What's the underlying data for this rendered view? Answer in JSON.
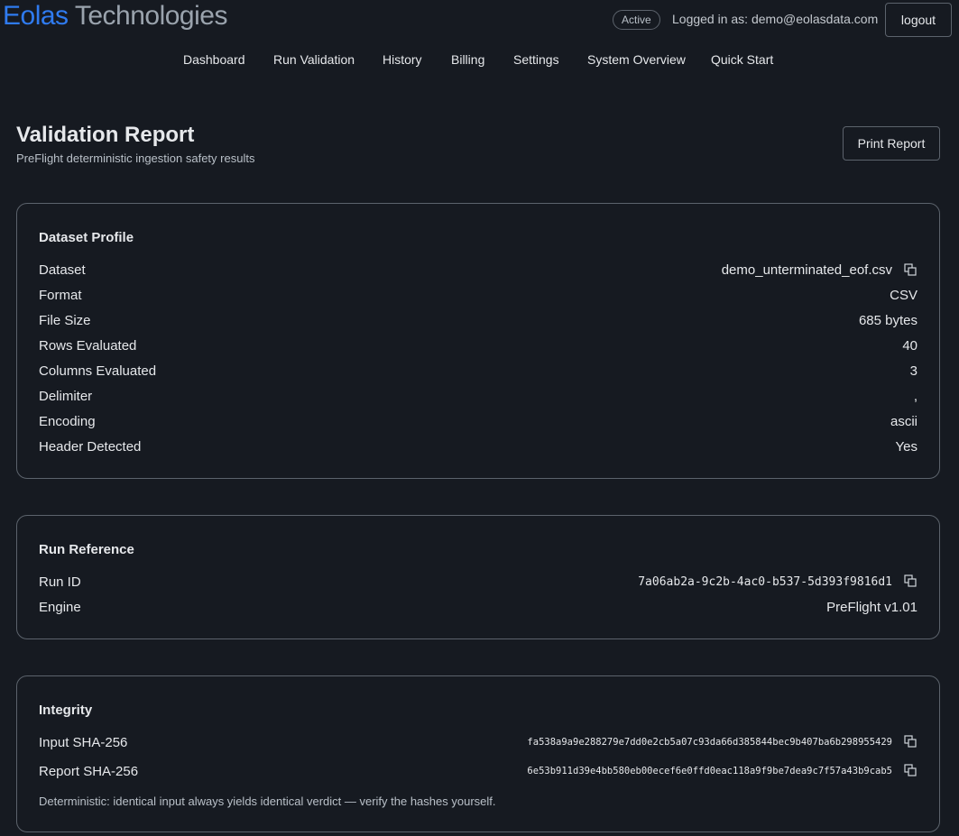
{
  "brand": {
    "part1": "Eolas",
    "part2": "Technologies"
  },
  "header": {
    "status": "Active",
    "logged_in": "Logged in as: demo@eolasdata.com",
    "logout_label": "logout"
  },
  "nav": {
    "items": [
      {
        "label": "Dashboard"
      },
      {
        "label": "Run Validation"
      },
      {
        "label": "History"
      },
      {
        "label": "Billing"
      },
      {
        "label": "Settings"
      },
      {
        "label": "System Overview"
      },
      {
        "label": "Quick Start"
      }
    ]
  },
  "page": {
    "title": "Validation Report",
    "subtitle": "PreFlight deterministic ingestion safety results",
    "print_label": "Print Report"
  },
  "dataset_profile": {
    "title": "Dataset Profile",
    "rows": [
      {
        "label": "Dataset",
        "value": "demo_unterminated_eof.csv"
      },
      {
        "label": "Format",
        "value": "CSV"
      },
      {
        "label": "File Size",
        "value": "685 bytes"
      },
      {
        "label": "Rows Evaluated",
        "value": "40"
      },
      {
        "label": "Columns Evaluated",
        "value": "3"
      },
      {
        "label": "Delimiter",
        "value": ","
      },
      {
        "label": "Encoding",
        "value": "ascii"
      },
      {
        "label": "Header Detected",
        "value": "Yes"
      }
    ]
  },
  "run_reference": {
    "title": "Run Reference",
    "rows": [
      {
        "label": "Run ID",
        "value": "7a06ab2a-9c2b-4ac0-b537-5d393f9816d1"
      },
      {
        "label": "Engine",
        "value": "PreFlight v1.01"
      }
    ]
  },
  "integrity": {
    "title": "Integrity",
    "rows": [
      {
        "label": "Input SHA-256",
        "value": "fa538a9a9e288279e7dd0e2cb5a07c93da66d385844bec9b407ba6b298955429"
      },
      {
        "label": "Report SHA-256",
        "value": "6e53b911d39e4bb580eb00ecef6e0ffd0eac118a9f9be7dea9c7f57a43b9cab5"
      }
    ],
    "note": "Deterministic: identical input always yields identical verdict — verify the hashes yourself."
  },
  "icons": {
    "copy": "copy-icon"
  },
  "colors": {
    "accent": "#2f7bf0",
    "background": "#161a21",
    "border": "#5c636c"
  }
}
